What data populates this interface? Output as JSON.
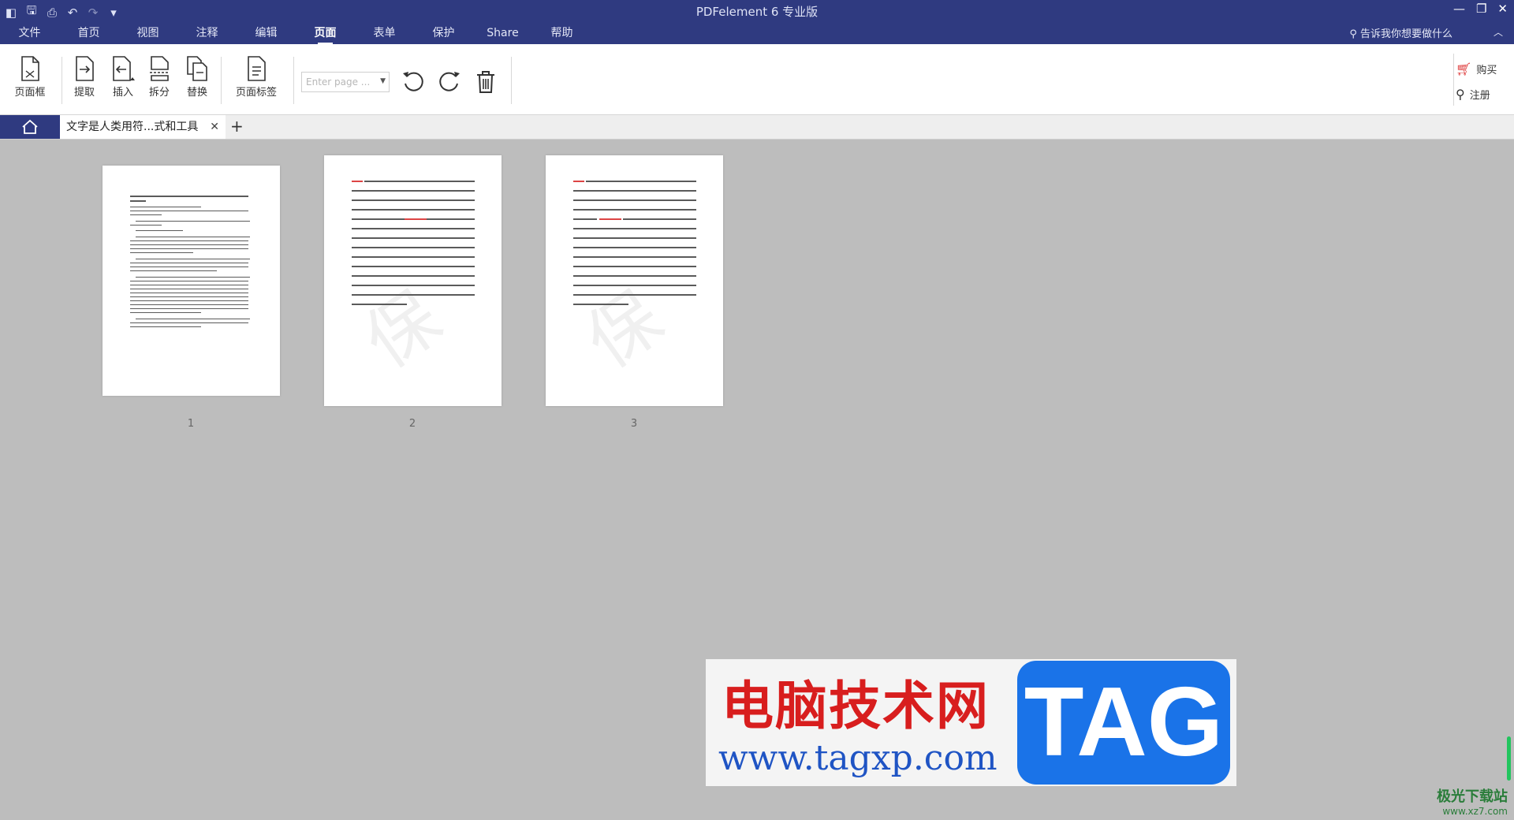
{
  "window": {
    "title": "PDFelement  6 专业版",
    "tell_me": "告诉我你想要做什么"
  },
  "menu": [
    "文件",
    "首页",
    "视图",
    "注释",
    "编辑",
    "页面",
    "表单",
    "保护",
    "Share",
    "帮助"
  ],
  "menu_active": "页面",
  "ribbon": {
    "page_box": "页面框",
    "extract": "提取",
    "insert": "插入",
    "split": "拆分",
    "replace": "替换",
    "page_label": "页面标签",
    "page_input_placeholder": "Enter page ...",
    "buy": "购买",
    "register": "注册"
  },
  "tabs": {
    "doc_title": "文字是人类用符...式和工具"
  },
  "pages": [
    {
      "number": "1"
    },
    {
      "number": "2"
    },
    {
      "number": "3"
    }
  ],
  "watermark": {
    "cn_text": "电脑技术网",
    "url": "www.tagxp.com",
    "tag": "TAG",
    "site": "极光下载站",
    "site_url": "www.xz7.com"
  },
  "colors": {
    "titlebar": "#2f3a80",
    "canvas": "#bdbdbd",
    "scroll_indicator": "#22c55e"
  }
}
